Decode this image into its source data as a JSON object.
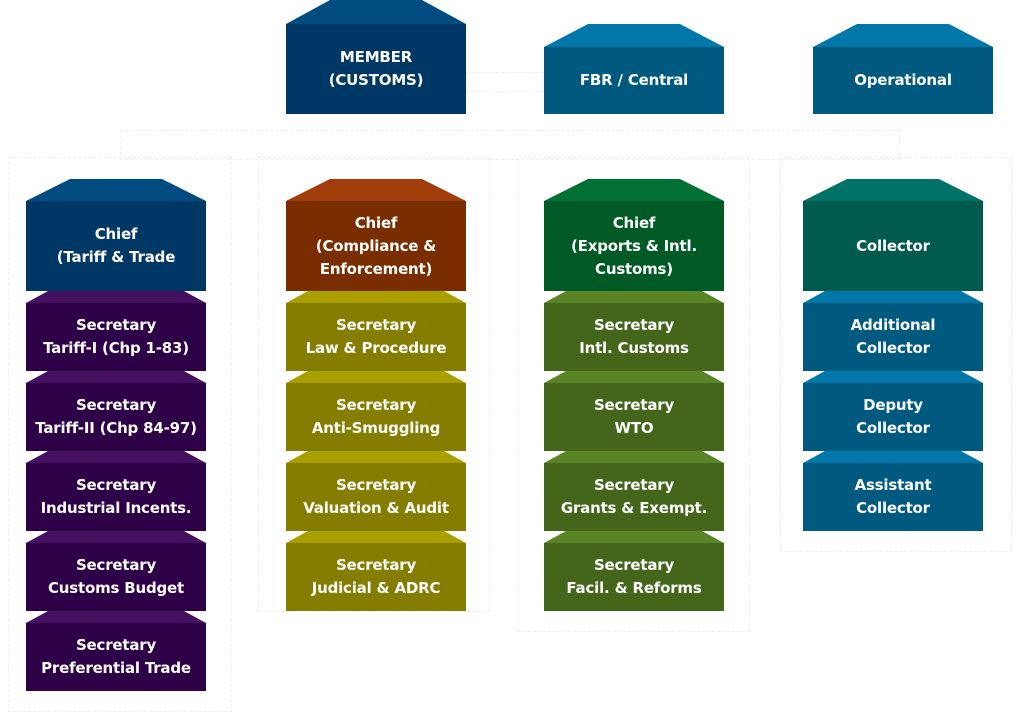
{
  "top_row": [
    {
      "id": "member-customs",
      "label": "MEMBER\n(CUSTOMS)",
      "body_color": "#003865",
      "cap_color": "#004b80"
    },
    {
      "id": "fbr-central",
      "label": "FBR / Central",
      "body_color": "#005a80",
      "cap_color": "#0077a8"
    },
    {
      "id": "operational",
      "label": "Operational",
      "body_color": "#005a80",
      "cap_color": "#0077a8"
    }
  ],
  "columns": [
    {
      "id": "tariff-trade",
      "chief": {
        "label": "Chief\n(Tariff & Trade",
        "body_color": "#003865",
        "cap_color": "#004b80"
      },
      "sub_body_color": "#2e0047",
      "sub_cap_color": "#451060",
      "items": [
        "Secretary\nTariff-I (Chp 1-83)",
        "Secretary\nTariff-II (Chp 84-97)",
        "Secretary\nIndustrial Incents.",
        "Secretary\nCustoms Budget",
        "Secretary\nPreferential Trade"
      ]
    },
    {
      "id": "compliance-enforcement",
      "chief": {
        "label": "Chief\n(Compliance &\nEnforcement)",
        "body_color": "#7a2e00",
        "cap_color": "#a03d0a"
      },
      "sub_body_color": "#857d00",
      "sub_cap_color": "#a99f00",
      "items": [
        "Secretary\nLaw & Procedure",
        "Secretary\nAnti-Smuggling",
        "Secretary\nValuation & Audit",
        "Secretary\nJudicial & ADRC"
      ]
    },
    {
      "id": "exports-intl-customs",
      "chief": {
        "label": "Chief\n(Exports & Intl.\nCustoms)",
        "body_color": "#005a25",
        "cap_color": "#007035"
      },
      "sub_body_color": "#43661a",
      "sub_cap_color": "#5a8527",
      "items": [
        "Secretary\nIntl. Customs",
        "Secretary\nWTO",
        "Secretary\nGrants & Exempt.",
        "Secretary\nFacil. & Reforms"
      ]
    },
    {
      "id": "collectorate",
      "chief": {
        "label": "Collector",
        "body_color": "#005a4e",
        "cap_color": "#007366"
      },
      "sub_body_color": "#005a80",
      "sub_cap_color": "#0077a8",
      "items": [
        "Additional\nCollector",
        "Deputy\nCollector",
        "Assistant\nCollector"
      ]
    }
  ]
}
